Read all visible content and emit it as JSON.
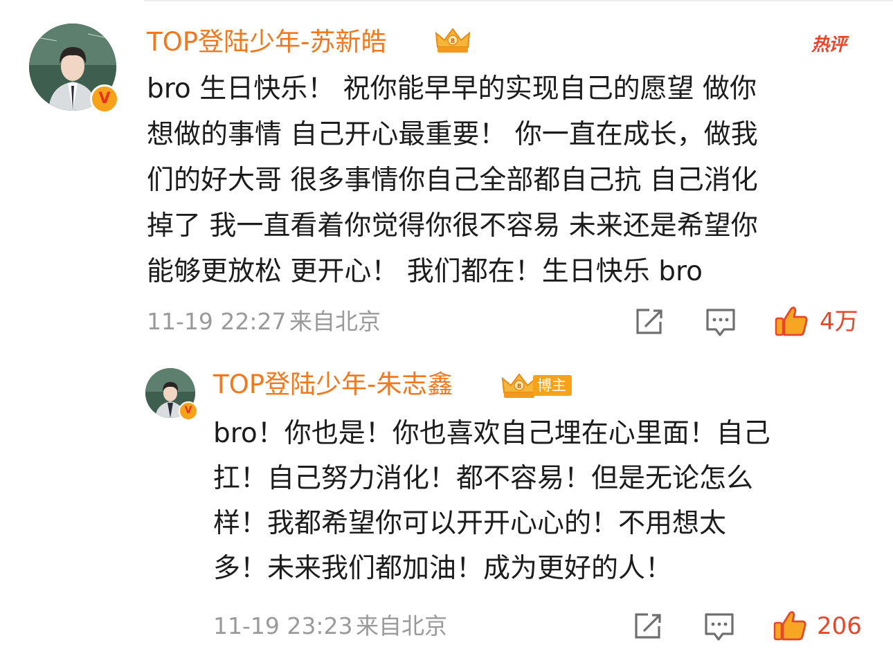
{
  "comments": [
    {
      "username": "TOP登陆少年-苏新皓",
      "badge": "热评",
      "content": "bro 生日快乐！ 祝你能早早的实现自己的愿望 做你\n想做的事情 自己开心最重要！ 你一直在成长，做我\n们的好大哥 很多事情你自己全部都自己抗 自己消化\n掉了 我一直看着你觉得你很不容易 未来还是希望你\n能够更放松 更开心！ 我们都在！生日快乐 bro",
      "timestamp": "11-19 22:27",
      "location": "来自北京",
      "likes": "4万"
    },
    {
      "username": "TOP登陆少年-朱志鑫",
      "badge": "博主",
      "content": "bro！你也是！你也喜欢自己埋在心里面！自己\n扛！自己努力消化！都不容易！但是无论怎么\n样！我都希望你可以开开心心的！不用想太\n多！未来我们都加油！成为更好的人！",
      "timestamp": "11-19 23:23",
      "location": "来自北京",
      "likes": "206"
    }
  ],
  "icons": {
    "share": "share-icon",
    "comment": "comment-icon",
    "like": "thumbs-up-icon",
    "verified": "verified-v-icon",
    "crown": "vip-crown-icon"
  },
  "colors": {
    "username": "#f3781d",
    "like": "#e8462a",
    "meta": "#9a9a9a",
    "badge_bg": "#f7a21b"
  }
}
